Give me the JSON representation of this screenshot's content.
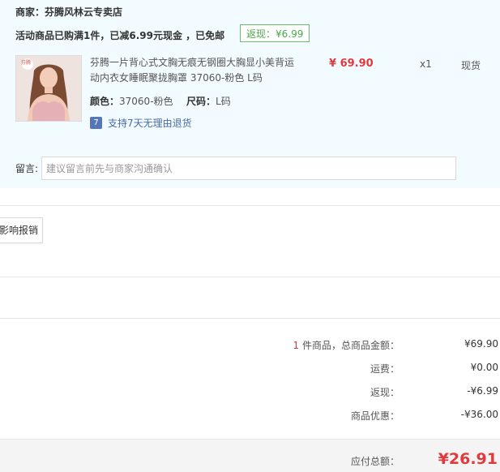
{
  "shop": {
    "merchant": "商家：芬腾风林云专卖店",
    "promo": "活动商品已购满1件，已减6.99元现金 ，已免邮",
    "cashback_badge": "返现：¥6.99"
  },
  "product": {
    "image_logo_text": "芬腾",
    "title": "芬腾一片背心式文胸无痕无钢圈大胸显小美背运动内衣女睡眠聚拢胸罩 37060-粉色 L码",
    "price": "¥ 69.90",
    "quantity": "x1",
    "stock_status": "现货",
    "color_label": "颜色：",
    "color_value": "37060-粉色",
    "size_label": "尺码：",
    "size_value": "L码",
    "return_icon": "7",
    "return_policy": "支持7天无理由退货"
  },
  "message": {
    "label": "留言:",
    "placeholder": "建议留言前先与商家沟通确认"
  },
  "reimburse_button": "影响报销",
  "summary": {
    "goods_count": "1",
    "goods_label": " 件商品，总商品金额：",
    "goods_amount": "¥69.90",
    "shipping_label": "运费：",
    "shipping_amount": "¥0.00",
    "cashback_label": "返现：",
    "cashback_amount": "-¥6.99",
    "discount_label": "商品优惠：",
    "discount_amount": "-¥36.00",
    "payable_label": "应付总额：",
    "payable_amount": "¥26.91"
  },
  "colors": {
    "panel_bg": "#f2fbff",
    "price_red": "#e4393c",
    "badge_green": "#4aa84a",
    "link_blue": "#4a6aa5"
  }
}
